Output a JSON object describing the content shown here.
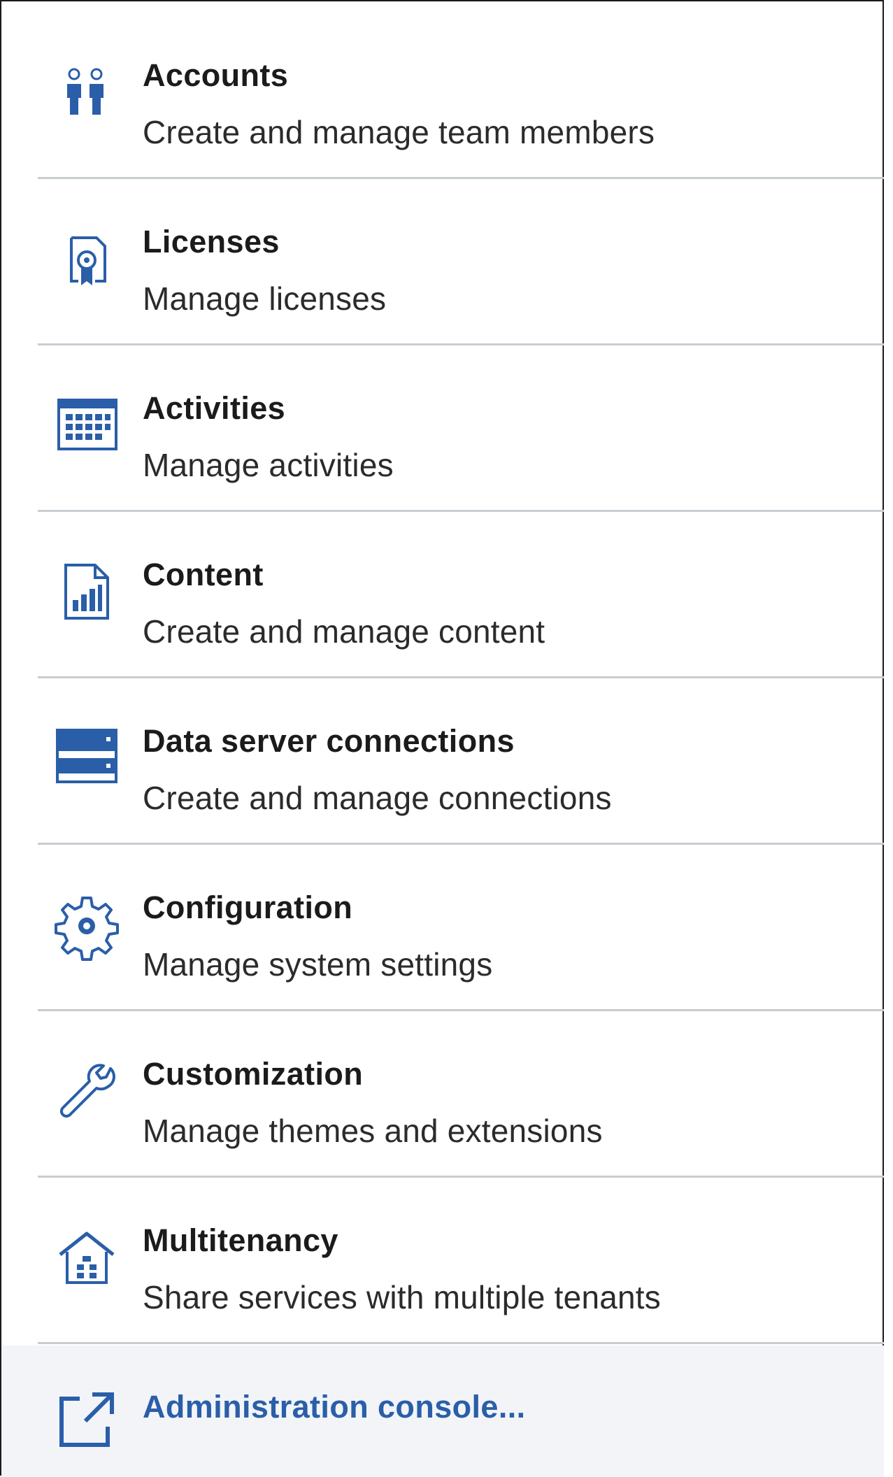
{
  "menu": {
    "items": [
      {
        "title": "Accounts",
        "description": "Create and manage team members",
        "icon": "accounts-icon"
      },
      {
        "title": "Licenses",
        "description": "Manage licenses",
        "icon": "license-icon"
      },
      {
        "title": "Activities",
        "description": "Manage activities",
        "icon": "calendar-icon"
      },
      {
        "title": "Content",
        "description": "Create and manage content",
        "icon": "content-report-icon"
      },
      {
        "title": "Data server connections",
        "description": "Create and manage connections",
        "icon": "data-server-icon"
      },
      {
        "title": "Configuration",
        "description": "Manage system settings",
        "icon": "gear-icon"
      },
      {
        "title": "Customization",
        "description": "Manage themes and extensions",
        "icon": "wrench-icon"
      },
      {
        "title": "Multitenancy",
        "description": "Share services with multiple tenants",
        "icon": "tenant-house-icon"
      }
    ],
    "console": {
      "label": "Administration console...",
      "icon": "launch-external-icon"
    }
  },
  "colors": {
    "icon": "#2a5ea8",
    "title": "#1b1b1b",
    "link": "#2a5ea8",
    "separator": "#c8cdd2",
    "console_bg": "#f2f4f8"
  }
}
